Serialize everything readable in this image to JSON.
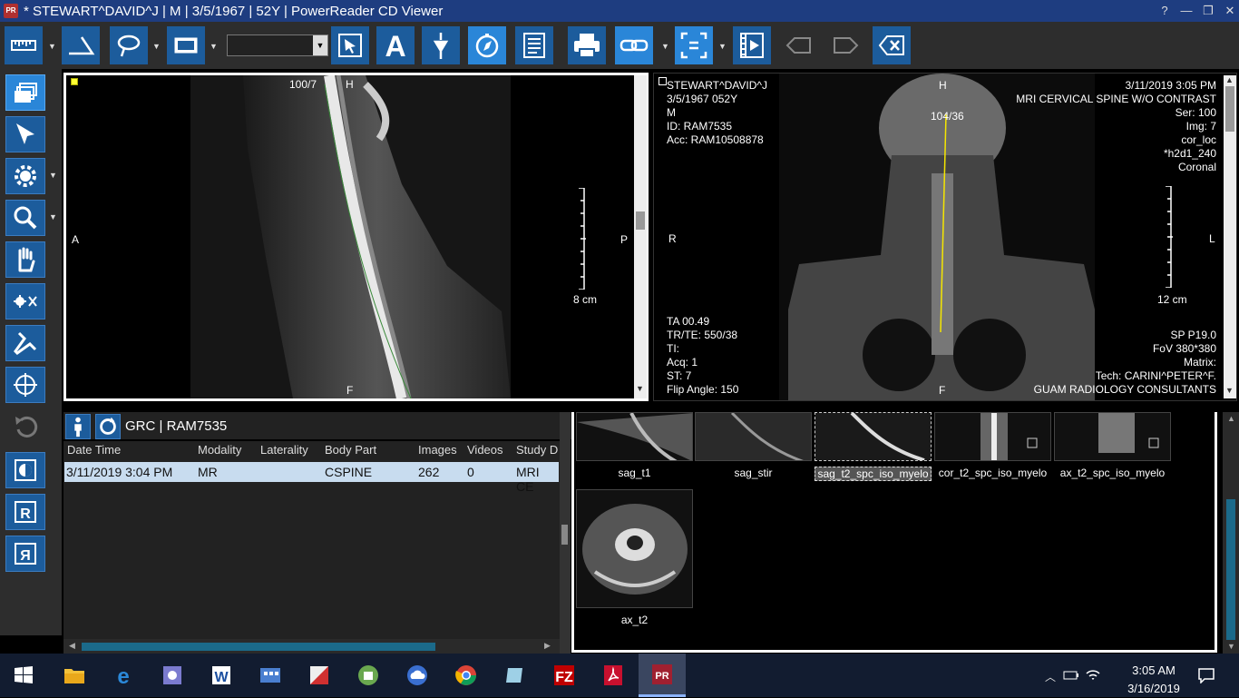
{
  "window": {
    "title": "* STEWART^DAVID^J | M | 3/5/1967 | 52Y | PowerReader CD Viewer",
    "controls": [
      "?",
      "—",
      "❐",
      "✕"
    ]
  },
  "toolbar": {
    "window_level_value": ""
  },
  "viewport1": {
    "image_index": "100/7",
    "orient_top": "H",
    "orient_bottom": "F",
    "orient_left": "A",
    "orient_right": "P",
    "scale": "8 cm"
  },
  "viewport2": {
    "patient_name": "STEWART^DAVID^J",
    "dob_age": "3/5/1967 052Y",
    "sex": "M",
    "patient_id": "ID: RAM7535",
    "accession": "Acc: RAM10508878",
    "datetime": "3/11/2019 3:05 PM",
    "study_desc": "MRI CERVICAL SPINE W/O CONTRAST",
    "series": "Ser: 100",
    "image": "Img: 7",
    "series_desc": "cor_loc",
    "sequence": "*h2d1_240",
    "plane": "Coronal",
    "image_index": "104/36",
    "orient_top": "H",
    "orient_bottom": "F",
    "orient_left": "R",
    "orient_right": "L",
    "scale": "12 cm",
    "ta": "TA 00.49",
    "tr_te": "TR/TE: 550/38",
    "ti": "TI:",
    "acq": "Acq: 1",
    "st": "ST: 7",
    "flip": "Flip Angle: 150",
    "sp": "SP P19.0",
    "fov": "FoV 380*380",
    "matrix": "Matrix:",
    "tech": "Tech: CARINI^PETER^F.",
    "institution": "GUAM RADIOLOGY CONSULTANTS"
  },
  "study": {
    "label": "GRC | RAM7535",
    "columns": [
      "Date Time",
      "Modality",
      "Laterality",
      "Body Part",
      "Images",
      "Videos",
      "Study D"
    ],
    "rows": [
      {
        "date_time": "3/11/2019 3:04 PM",
        "modality": "MR",
        "laterality": "",
        "body_part": "CSPINE",
        "images": "262",
        "videos": "0",
        "study_desc": "MRI CE"
      }
    ]
  },
  "thumbnails": [
    {
      "label": "sag_t1",
      "selected": false
    },
    {
      "label": "sag_stir",
      "selected": false
    },
    {
      "label": "sag_t2_spc_iso_myelo",
      "selected": true
    },
    {
      "label": "cor_t2_spc_iso_myelo",
      "selected": false
    },
    {
      "label": "ax_t2_spc_iso_myelo",
      "selected": false
    },
    {
      "label": "ax_t2",
      "selected": false
    }
  ],
  "taskbar": {
    "time": "3:05 AM",
    "date": "3/16/2019",
    "active_app_label": "PR"
  },
  "colors": {
    "accent": "#2a86d8",
    "titlebar": "#1e3d80",
    "selected_row": "#c8dcef"
  }
}
